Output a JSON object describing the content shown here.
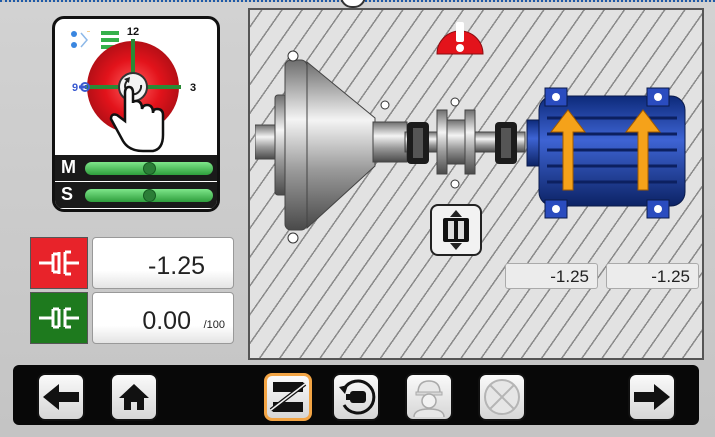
{
  "alignment": {
    "clock_labels": {
      "top": "12",
      "right": "3",
      "left": "9"
    },
    "level_labels": {
      "motor": "M",
      "stationary": "S"
    },
    "readings": {
      "horizontal": {
        "value": "-1.25"
      },
      "vertical": {
        "value": "0.00",
        "unit": "/100"
      }
    },
    "foot_values": {
      "front": "-1.25",
      "rear": "-1.25"
    }
  },
  "colors": {
    "alert_red": "#e3131b",
    "clock_red": "#e3131b",
    "level_green": "#3cb44b",
    "motor_blue": "#1d3da0",
    "arrow_orange": "#f5a21a",
    "active_border": "#f2a444"
  },
  "icons": {
    "alert": "exclamation-icon",
    "hand": "pointing-hand-icon",
    "back": "arrow-left-icon",
    "home": "home-icon",
    "next": "arrow-right-icon"
  }
}
